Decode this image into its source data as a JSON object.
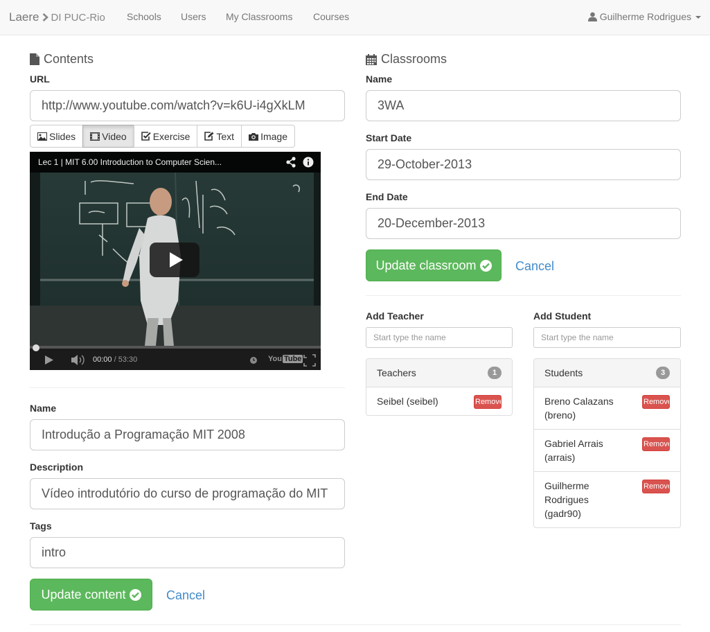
{
  "navbar": {
    "brand": "Laere",
    "brand_sub": "DI PUC-Rio",
    "links": [
      "Schools",
      "Users",
      "My Classrooms",
      "Courses"
    ],
    "user": "Guilherme Rodrigues"
  },
  "contents": {
    "header": "Contents",
    "url_label": "URL",
    "url_value": "http://www.youtube.com/watch?v=k6U-i4gXkLM",
    "tabs": [
      "Slides",
      "Video",
      "Exercise",
      "Text",
      "Image"
    ],
    "active_tab": "Video",
    "video": {
      "title": "Lec 1 | MIT 6.00 Introduction to Computer Scien...",
      "time": "00:00",
      "duration": "/ 53:30",
      "progress": 0
    },
    "name_label": "Name",
    "name_value": "Introdução a Programação MIT 2008",
    "desc_label": "Description",
    "desc_value": "Vídeo introdutório do curso de programação do MIT",
    "tags_label": "Tags",
    "tags_value": "intro",
    "update_label": "Update content",
    "cancel_label": "Cancel"
  },
  "classrooms": {
    "header": "Classrooms",
    "name_label": "Name",
    "name_value": "3WA",
    "start_label": "Start Date",
    "start_value": "29-October-2013",
    "end_label": "End Date",
    "end_value": "20-December-2013",
    "update_label": "Update classroom",
    "cancel_label": "Cancel",
    "add_teacher_label": "Add Teacher",
    "add_teacher_placeholder": "Start type the name",
    "add_student_label": "Add Student",
    "add_student_placeholder": "Start type the name",
    "teachers_title": "Teachers",
    "teachers_count": "1",
    "teachers": [
      {
        "name": "Seibel (seibel)",
        "remove": "Remove"
      }
    ],
    "students_title": "Students",
    "students_count": "3",
    "students": [
      {
        "name": "Breno Calazans (breno)",
        "remove": "Remove"
      },
      {
        "name": "Gabriel Arrais (arrais)",
        "remove": "Remove"
      },
      {
        "name": "Guilherme Rodrigues (gadr90)",
        "remove": "Remove"
      }
    ]
  },
  "colors": {
    "success": "#5cb85c",
    "danger": "#d9534f",
    "link": "#428bca"
  }
}
